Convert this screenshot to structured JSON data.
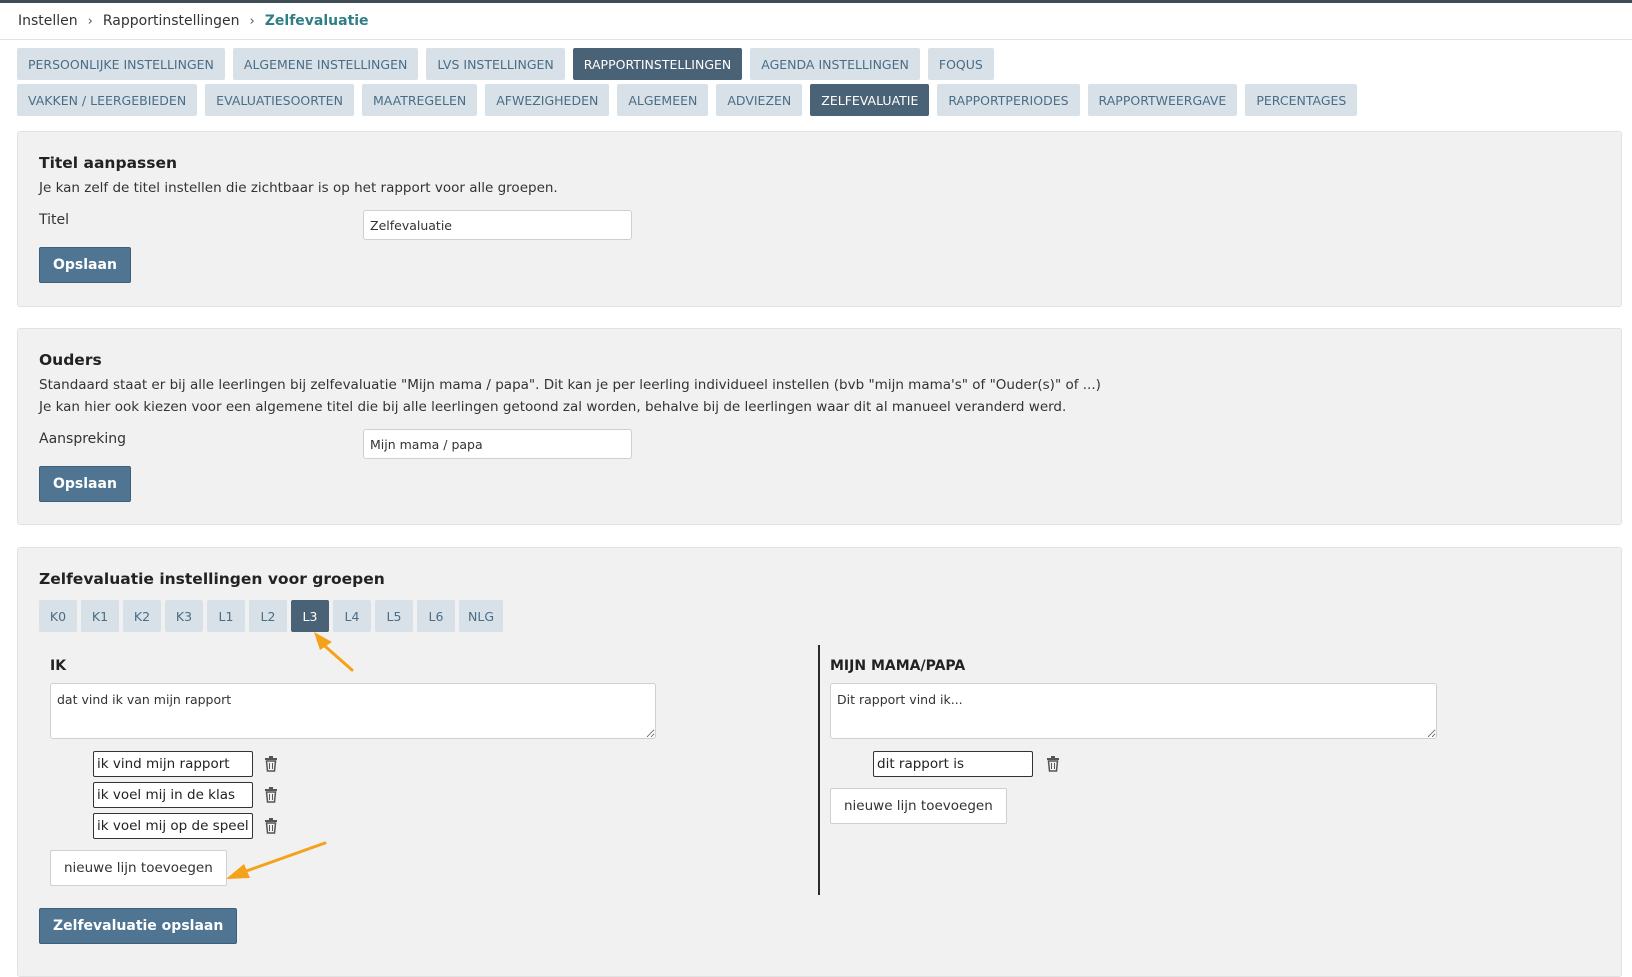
{
  "breadcrumb": {
    "items": [
      "Instellen",
      "Rapportinstellingen"
    ],
    "current": "Zelfevaluatie"
  },
  "top_tabs": [
    {
      "label": "PERSOONLIJKE INSTELLINGEN",
      "active": false
    },
    {
      "label": "ALGEMENE INSTELLINGEN",
      "active": false
    },
    {
      "label": "LVS INSTELLINGEN",
      "active": false
    },
    {
      "label": "RAPPORTINSTELLINGEN",
      "active": true
    },
    {
      "label": "AGENDA INSTELLINGEN",
      "active": false
    },
    {
      "label": "FOQUS",
      "active": false
    }
  ],
  "sub_tabs": [
    {
      "label": "VAKKEN / LEERGEBIEDEN",
      "active": false
    },
    {
      "label": "EVALUATIESOORTEN",
      "active": false
    },
    {
      "label": "MAATREGELEN",
      "active": false
    },
    {
      "label": "AFWEZIGHEDEN",
      "active": false
    },
    {
      "label": "ALGEMEEN",
      "active": false
    },
    {
      "label": "ADVIEZEN",
      "active": false
    },
    {
      "label": "ZELFEVALUATIE",
      "active": true
    },
    {
      "label": "RAPPORTPERIODES",
      "active": false
    },
    {
      "label": "RAPPORTWEERGAVE",
      "active": false
    },
    {
      "label": "PERCENTAGES",
      "active": false
    }
  ],
  "title_panel": {
    "heading": "Titel aanpassen",
    "description": "Je kan zelf de titel instellen die zichtbaar is op het rapport voor alle groepen.",
    "field_label": "Titel",
    "field_value": "Zelfevaluatie",
    "save_label": "Opslaan"
  },
  "parents_panel": {
    "heading": "Ouders",
    "description_1": "Standaard staat er bij alle leerlingen bij zelfevaluatie \"Mijn mama / papa\". Dit kan je per leerling individueel instellen (bvb \"mijn mama's\" of \"Ouder(s)\" of ...)",
    "description_2": "Je kan hier ook kiezen voor een algemene titel die bij alle leerlingen getoond zal worden, behalve bij de leerlingen waar dit al manueel veranderd werd.",
    "field_label": "Aanspreking",
    "field_value": "Mijn mama / papa",
    "save_label": "Opslaan"
  },
  "groups_panel": {
    "heading": "Zelfevaluatie instellingen voor groepen",
    "groups": [
      {
        "label": "K0",
        "active": false
      },
      {
        "label": "K1",
        "active": false
      },
      {
        "label": "K2",
        "active": false
      },
      {
        "label": "K3",
        "active": false
      },
      {
        "label": "L1",
        "active": false
      },
      {
        "label": "L2",
        "active": false
      },
      {
        "label": "L3",
        "active": true
      },
      {
        "label": "L4",
        "active": false
      },
      {
        "label": "L5",
        "active": false
      },
      {
        "label": "L6",
        "active": false
      },
      {
        "label": "NLG",
        "active": false
      }
    ],
    "ik": {
      "heading": "IK",
      "intro_text": "dat vind ik van mijn rapport",
      "lines": [
        "ik vind mijn rapport",
        "ik voel mij in de klas",
        "ik voel mij op de speelplaats"
      ],
      "add_line_label": "nieuwe lijn toevoegen"
    },
    "parents": {
      "heading": "MIJN MAMA/PAPA",
      "intro_text": "Dit rapport vind ik...",
      "lines": [
        "dit rapport is"
      ],
      "add_line_label": "nieuwe lijn toevoegen"
    },
    "save_label": "Zelfevaluatie opslaan"
  },
  "colors": {
    "accent": "#4a6275",
    "tab_bg": "#d8e1e8",
    "button": "#4f7592",
    "breadcrumb_current": "#2f7f86",
    "annotation_arrow": "#f5a21b"
  },
  "icons": {
    "trash": "trash-icon",
    "breadcrumb_separator": "chevron-right-icon"
  }
}
